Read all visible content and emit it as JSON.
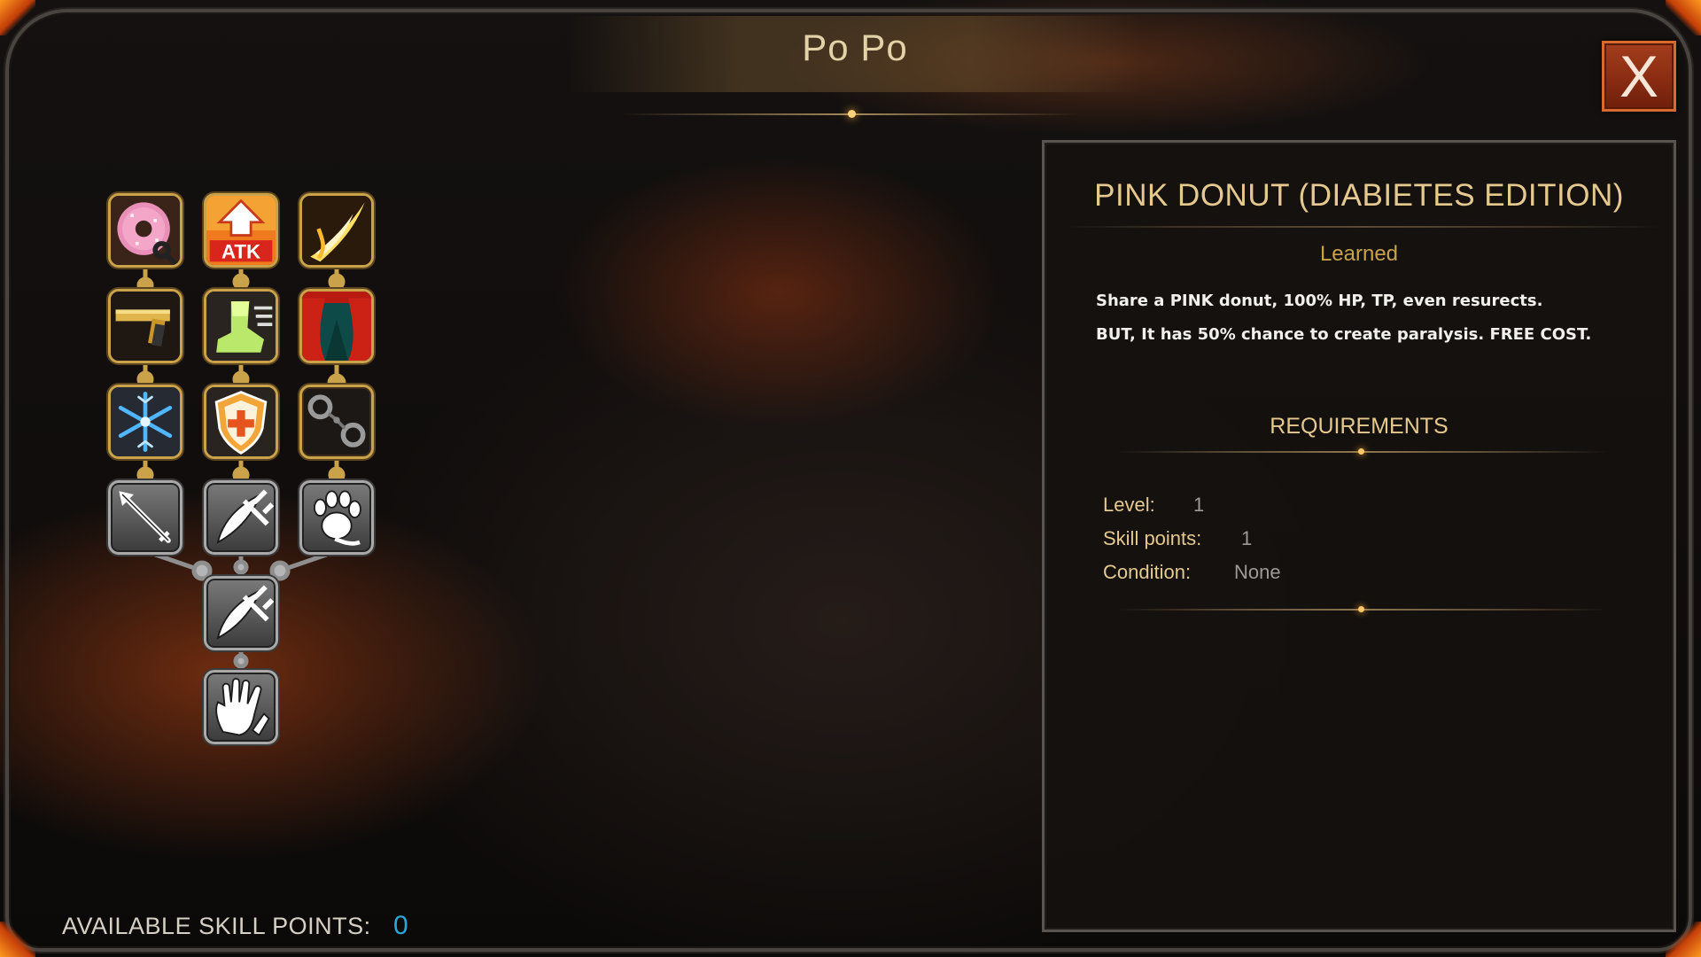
{
  "window": {
    "title": "Po Po",
    "close_label": "X"
  },
  "skill_tree": {
    "skills": [
      {
        "name": "Pink Donut (Diabietes Edition)",
        "icon": "pink-donut-icon",
        "style": "gold",
        "selected": true
      },
      {
        "icon": "atk-up-icon",
        "style": "gold",
        "badge": "ATK"
      },
      {
        "icon": "flame-slash-icon",
        "style": "gold"
      },
      {
        "icon": "golden-pistol-icon",
        "style": "gold"
      },
      {
        "icon": "swift-boot-icon",
        "style": "gold"
      },
      {
        "icon": "red-curtain-icon",
        "style": "gold"
      },
      {
        "icon": "snowflake-icon",
        "style": "gold"
      },
      {
        "icon": "medic-shield-icon",
        "style": "gold"
      },
      {
        "icon": "handcuffs-icon",
        "style": "gold"
      },
      {
        "icon": "spear-icon",
        "style": "silver"
      },
      {
        "icon": "crossed-blades-icon",
        "style": "silver"
      },
      {
        "icon": "paw-claw-icon",
        "style": "silver"
      },
      {
        "icon": "crossed-blades-icon",
        "style": "silver"
      },
      {
        "icon": "open-hand-icon",
        "style": "silver"
      }
    ],
    "available_label": "AVAILABLE SKILL POINTS:",
    "available_points": "0"
  },
  "detail": {
    "name": "PINK DONUT (DIABIETES EDITION)",
    "status": "Learned",
    "description_lines": [
      "Share a PINK donut, 100% HP, TP, even resurects.",
      "BUT, It has 50% chance to create paralysis. FREE COST."
    ],
    "requirements_title": "REQUIREMENTS",
    "requirements": [
      {
        "label": "Level:",
        "value": "1"
      },
      {
        "label": "Skill points:",
        "value": "1"
      },
      {
        "label": "Condition:",
        "value": "None"
      }
    ]
  },
  "colors": {
    "gold_accent": "#e6c98e",
    "points_value": "#2aa9d9",
    "close_button": "#8a2c12"
  }
}
